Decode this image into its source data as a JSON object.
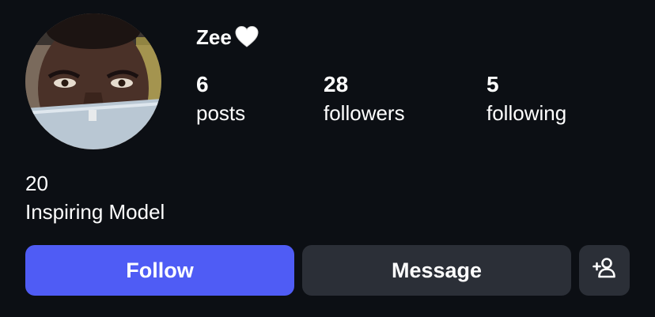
{
  "profile": {
    "username": "Zee",
    "username_emoji": "white-heart-icon",
    "avatar": "profile-avatar"
  },
  "stats": {
    "posts": {
      "count": "6",
      "label": "posts"
    },
    "followers": {
      "count": "28",
      "label": "followers"
    },
    "following": {
      "count": "5",
      "label": "following"
    }
  },
  "bio": {
    "line1": "20",
    "line2": "Inspiring Model"
  },
  "actions": {
    "follow_label": "Follow",
    "message_label": "Message",
    "add_user_icon": "add-user-icon"
  },
  "colors": {
    "background": "#0c0f14",
    "follow_button": "#4f5cf5",
    "secondary_button": "#2b2f37",
    "text": "#ffffff"
  }
}
